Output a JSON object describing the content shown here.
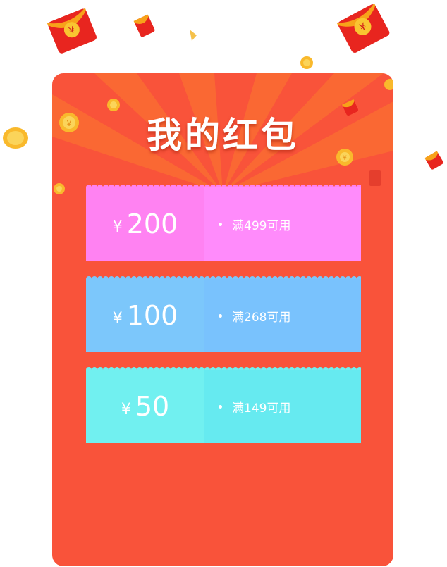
{
  "title": "我的红包",
  "currency_symbol": "¥",
  "coupons": [
    {
      "amount": "200",
      "condition": "满499可用",
      "left_color": "#ff82f2",
      "right_color": "#ff8bfb"
    },
    {
      "amount": "100",
      "condition": "满268可用",
      "left_color": "#7cc7fb",
      "right_color": "#79c2fd"
    },
    {
      "amount": "50",
      "condition": "满149可用",
      "left_color": "#71f0f0",
      "right_color": "#66eaf0"
    }
  ],
  "colors": {
    "panel": "#f9533a",
    "ray": "#fb7a2e"
  },
  "icons": [
    "red-envelope-icon",
    "gold-coin-icon",
    "yen-symbol-icon"
  ]
}
